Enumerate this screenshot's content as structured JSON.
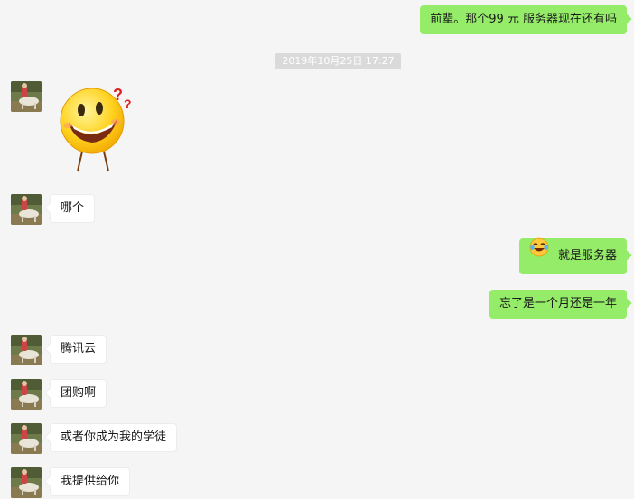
{
  "timestamp": "2019年10月25日 17:27",
  "messages": [
    {
      "id": "m1",
      "side": "out",
      "text": "前辈。那个99 元 服务器现在还有吗"
    },
    {
      "id": "m2",
      "side": "in",
      "type": "sticker",
      "icon": "confused-smiley-sticker"
    },
    {
      "id": "m3",
      "side": "in",
      "text": "哪个"
    },
    {
      "id": "m4",
      "side": "out",
      "icon": "crying-laughing-emoji",
      "text": "就是服务器"
    },
    {
      "id": "m5",
      "side": "out",
      "text": "忘了是一个月还是一年"
    },
    {
      "id": "m6",
      "side": "in",
      "text": "腾讯云"
    },
    {
      "id": "m7",
      "side": "in",
      "text": "团购啊"
    },
    {
      "id": "m8",
      "side": "in",
      "text": "或者你成为我的学徒"
    },
    {
      "id": "m9",
      "side": "in",
      "text": "我提供给你"
    }
  ],
  "colors": {
    "background": "#f5f5f5",
    "outgoing_bubble": "#95ec69",
    "incoming_bubble": "#ffffff",
    "timestamp_bg": "#dadada"
  }
}
